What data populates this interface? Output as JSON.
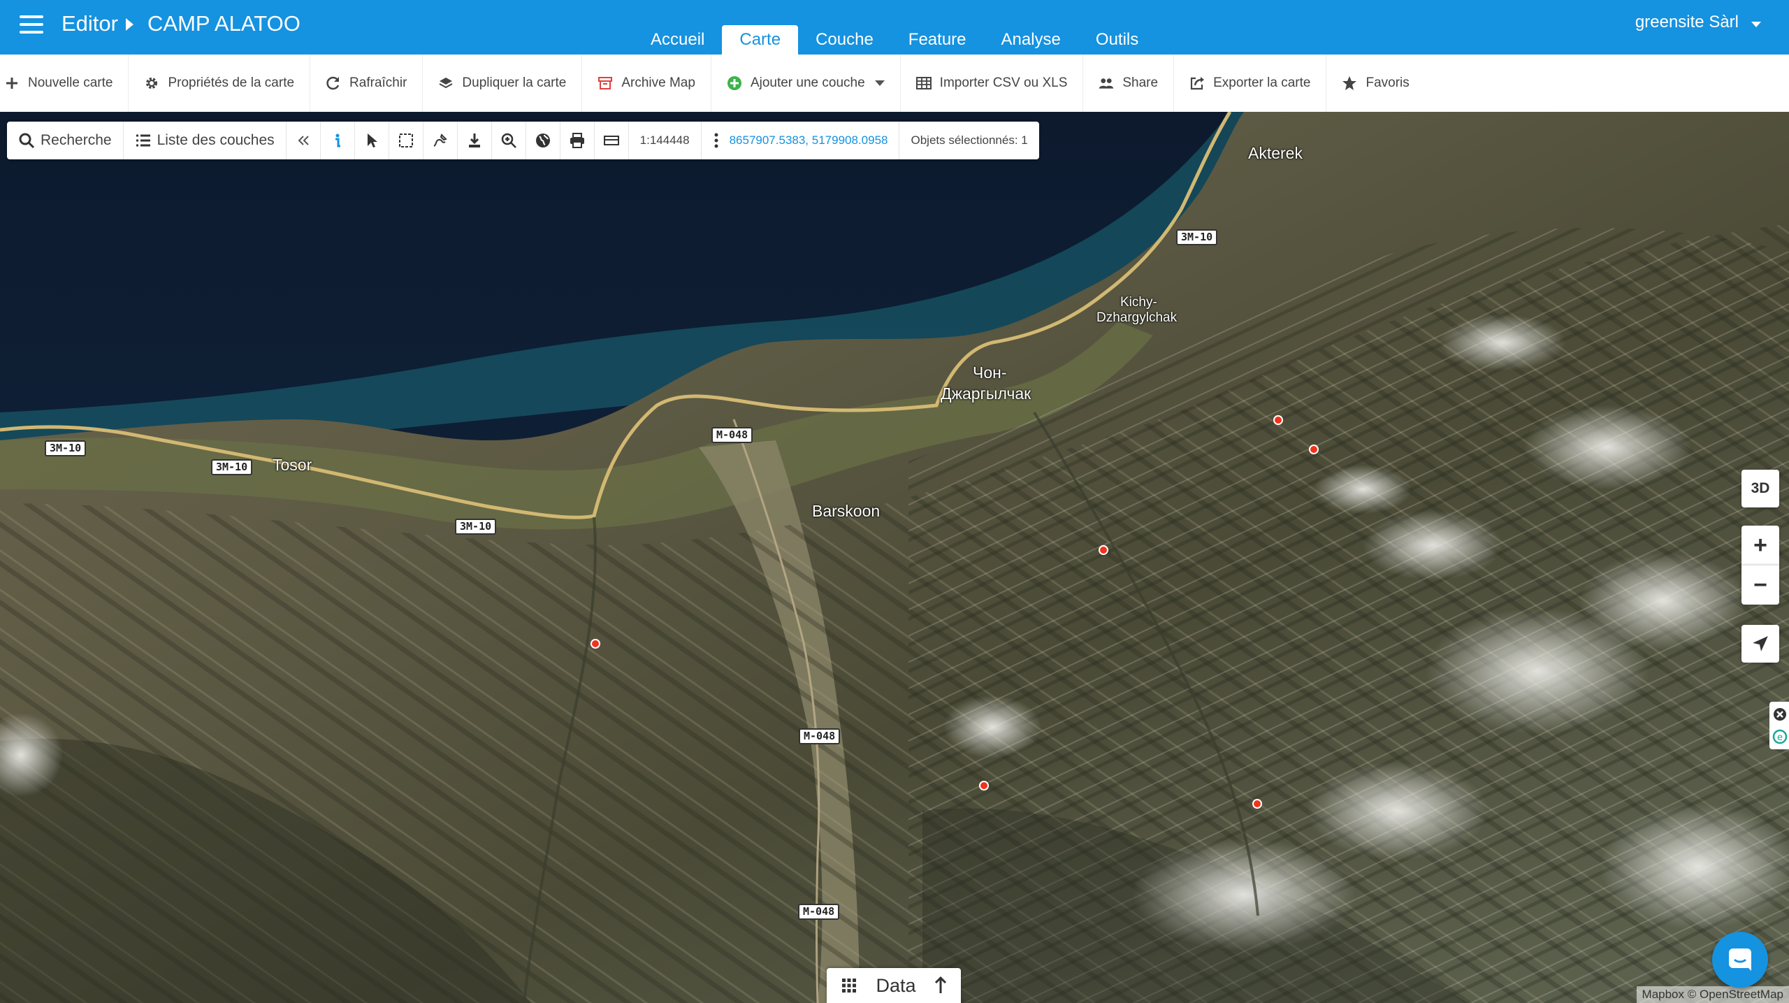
{
  "header": {
    "breadcrumb_root": "Editor",
    "breadcrumb_current": "CAMP ALATOO",
    "tabs": [
      {
        "label": "Accueil",
        "active": false
      },
      {
        "label": "Carte",
        "active": true
      },
      {
        "label": "Couche",
        "active": false
      },
      {
        "label": "Feature",
        "active": false
      },
      {
        "label": "Analyse",
        "active": false
      },
      {
        "label": "Outils",
        "active": false
      }
    ],
    "user": "greensite Sàrl",
    "colors": {
      "bar": "#1592e0",
      "text": "#ffffff"
    }
  },
  "toolbar": {
    "items": [
      {
        "label": "Nouvelle carte",
        "icon": "plus-icon"
      },
      {
        "label": "Propriétés de la carte",
        "icon": "gear-icon"
      },
      {
        "label": "Rafraîchir",
        "icon": "refresh-icon"
      },
      {
        "label": "Dupliquer la carte",
        "icon": "layers-stack-icon"
      },
      {
        "label": "Archive Map",
        "icon": "archive-icon"
      },
      {
        "label": "Ajouter une couche",
        "icon": "plus-circle-icon"
      },
      {
        "label": "Importer CSV ou XLS",
        "icon": "table-icon"
      },
      {
        "label": "Share",
        "icon": "users-icon"
      },
      {
        "label": "Exporter la carte",
        "icon": "export-icon"
      },
      {
        "label": "Favoris",
        "icon": "star-icon"
      }
    ]
  },
  "map_tools": {
    "search_label": "Recherche",
    "layers_label": "Liste des couches",
    "scale": "1:144448",
    "coordinates": "8657907.5383, 5179908.0958",
    "selected": "Objets sélectionnés: 1",
    "icons": [
      "collapse-icon",
      "info-icon",
      "pointer-icon",
      "select-box-icon",
      "draw-path-icon",
      "download-icon",
      "zoom-in-icon",
      "globe-icon",
      "print-icon",
      "ruler-icon",
      "more-icon"
    ]
  },
  "map": {
    "places": [
      "Akterek",
      "Kichy-",
      "Dzhargylchak",
      "Чон-",
      "Джаргылчак",
      "Tosor",
      "Barskoon"
    ],
    "roads": [
      "ЗМ-10",
      "ЗМ-10",
      "ЗМ-10",
      "ЗМ-10",
      "М-048",
      "М-048",
      "М-048"
    ],
    "marker_color": "#f2321b",
    "marker_count": 6
  },
  "controls": {
    "view_3d": "3D",
    "zoom_in": "+",
    "zoom_out": "−"
  },
  "data_panel": {
    "label": "Data"
  },
  "attribution": "Mapbox © OpenStreetMap"
}
